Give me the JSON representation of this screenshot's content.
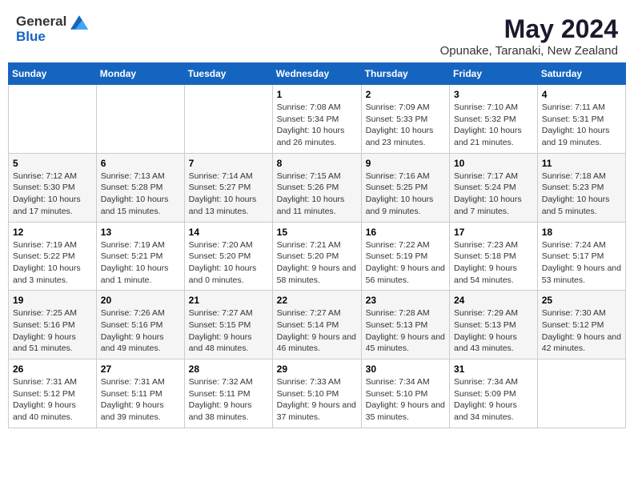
{
  "header": {
    "logo": {
      "general": "General",
      "blue": "Blue"
    },
    "title": "May 2024",
    "location": "Opunake, Taranaki, New Zealand"
  },
  "days_of_week": [
    "Sunday",
    "Monday",
    "Tuesday",
    "Wednesday",
    "Thursday",
    "Friday",
    "Saturday"
  ],
  "weeks": [
    [
      null,
      null,
      null,
      {
        "day": 1,
        "sunrise": "7:08 AM",
        "sunset": "5:34 PM",
        "daylight": "10 hours and 26 minutes."
      },
      {
        "day": 2,
        "sunrise": "7:09 AM",
        "sunset": "5:33 PM",
        "daylight": "10 hours and 23 minutes."
      },
      {
        "day": 3,
        "sunrise": "7:10 AM",
        "sunset": "5:32 PM",
        "daylight": "10 hours and 21 minutes."
      },
      {
        "day": 4,
        "sunrise": "7:11 AM",
        "sunset": "5:31 PM",
        "daylight": "10 hours and 19 minutes."
      }
    ],
    [
      {
        "day": 5,
        "sunrise": "7:12 AM",
        "sunset": "5:30 PM",
        "daylight": "10 hours and 17 minutes."
      },
      {
        "day": 6,
        "sunrise": "7:13 AM",
        "sunset": "5:28 PM",
        "daylight": "10 hours and 15 minutes."
      },
      {
        "day": 7,
        "sunrise": "7:14 AM",
        "sunset": "5:27 PM",
        "daylight": "10 hours and 13 minutes."
      },
      {
        "day": 8,
        "sunrise": "7:15 AM",
        "sunset": "5:26 PM",
        "daylight": "10 hours and 11 minutes."
      },
      {
        "day": 9,
        "sunrise": "7:16 AM",
        "sunset": "5:25 PM",
        "daylight": "10 hours and 9 minutes."
      },
      {
        "day": 10,
        "sunrise": "7:17 AM",
        "sunset": "5:24 PM",
        "daylight": "10 hours and 7 minutes."
      },
      {
        "day": 11,
        "sunrise": "7:18 AM",
        "sunset": "5:23 PM",
        "daylight": "10 hours and 5 minutes."
      }
    ],
    [
      {
        "day": 12,
        "sunrise": "7:19 AM",
        "sunset": "5:22 PM",
        "daylight": "10 hours and 3 minutes."
      },
      {
        "day": 13,
        "sunrise": "7:19 AM",
        "sunset": "5:21 PM",
        "daylight": "10 hours and 1 minute."
      },
      {
        "day": 14,
        "sunrise": "7:20 AM",
        "sunset": "5:20 PM",
        "daylight": "10 hours and 0 minutes."
      },
      {
        "day": 15,
        "sunrise": "7:21 AM",
        "sunset": "5:20 PM",
        "daylight": "9 hours and 58 minutes."
      },
      {
        "day": 16,
        "sunrise": "7:22 AM",
        "sunset": "5:19 PM",
        "daylight": "9 hours and 56 minutes."
      },
      {
        "day": 17,
        "sunrise": "7:23 AM",
        "sunset": "5:18 PM",
        "daylight": "9 hours and 54 minutes."
      },
      {
        "day": 18,
        "sunrise": "7:24 AM",
        "sunset": "5:17 PM",
        "daylight": "9 hours and 53 minutes."
      }
    ],
    [
      {
        "day": 19,
        "sunrise": "7:25 AM",
        "sunset": "5:16 PM",
        "daylight": "9 hours and 51 minutes."
      },
      {
        "day": 20,
        "sunrise": "7:26 AM",
        "sunset": "5:16 PM",
        "daylight": "9 hours and 49 minutes."
      },
      {
        "day": 21,
        "sunrise": "7:27 AM",
        "sunset": "5:15 PM",
        "daylight": "9 hours and 48 minutes."
      },
      {
        "day": 22,
        "sunrise": "7:27 AM",
        "sunset": "5:14 PM",
        "daylight": "9 hours and 46 minutes."
      },
      {
        "day": 23,
        "sunrise": "7:28 AM",
        "sunset": "5:13 PM",
        "daylight": "9 hours and 45 minutes."
      },
      {
        "day": 24,
        "sunrise": "7:29 AM",
        "sunset": "5:13 PM",
        "daylight": "9 hours and 43 minutes."
      },
      {
        "day": 25,
        "sunrise": "7:30 AM",
        "sunset": "5:12 PM",
        "daylight": "9 hours and 42 minutes."
      }
    ],
    [
      {
        "day": 26,
        "sunrise": "7:31 AM",
        "sunset": "5:12 PM",
        "daylight": "9 hours and 40 minutes."
      },
      {
        "day": 27,
        "sunrise": "7:31 AM",
        "sunset": "5:11 PM",
        "daylight": "9 hours and 39 minutes."
      },
      {
        "day": 28,
        "sunrise": "7:32 AM",
        "sunset": "5:11 PM",
        "daylight": "9 hours and 38 minutes."
      },
      {
        "day": 29,
        "sunrise": "7:33 AM",
        "sunset": "5:10 PM",
        "daylight": "9 hours and 37 minutes."
      },
      {
        "day": 30,
        "sunrise": "7:34 AM",
        "sunset": "5:10 PM",
        "daylight": "9 hours and 35 minutes."
      },
      {
        "day": 31,
        "sunrise": "7:34 AM",
        "sunset": "5:09 PM",
        "daylight": "9 hours and 34 minutes."
      },
      null
    ]
  ]
}
